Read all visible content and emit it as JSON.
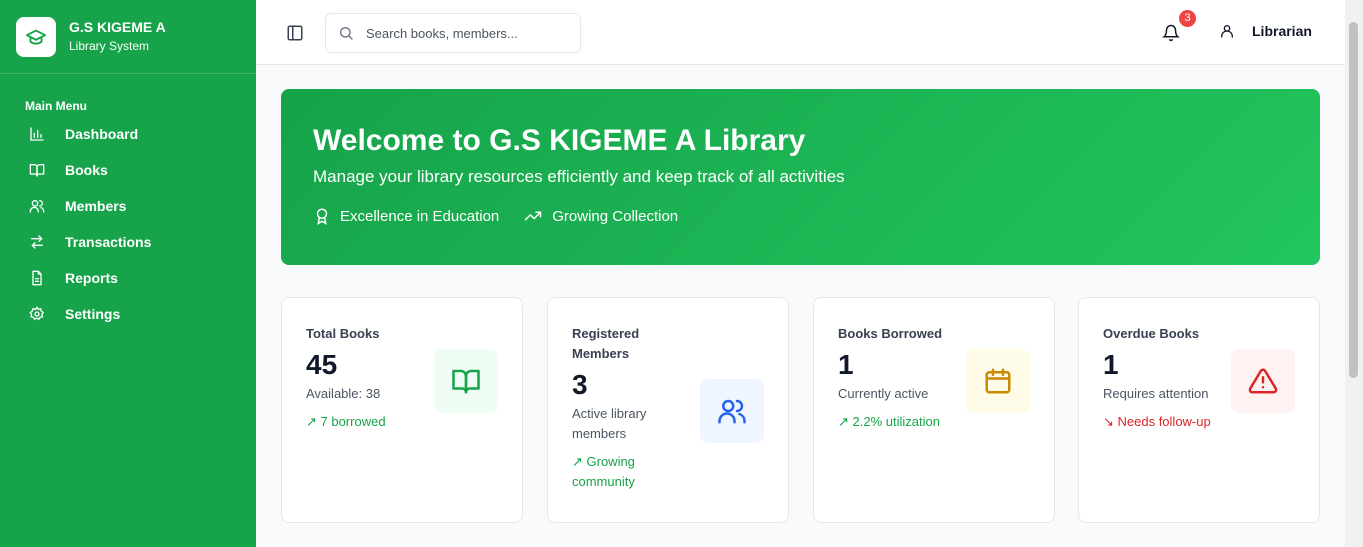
{
  "brand": {
    "name": "G.S KIGEME A",
    "subtitle": "Library System"
  },
  "sidebar": {
    "menu_title": "Main Menu",
    "items": [
      {
        "label": "Dashboard",
        "icon": "bar-chart-icon"
      },
      {
        "label": "Books",
        "icon": "book-open-icon"
      },
      {
        "label": "Members",
        "icon": "users-icon"
      },
      {
        "label": "Transactions",
        "icon": "arrows-left-right-icon"
      },
      {
        "label": "Reports",
        "icon": "file-text-icon"
      },
      {
        "label": "Settings",
        "icon": "gear-icon"
      }
    ]
  },
  "topbar": {
    "search_placeholder": "Search books, members...",
    "notification_count": "3",
    "user_label": "Librarian"
  },
  "hero": {
    "title": "Welcome to G.S KIGEME A Library",
    "subtitle": "Manage your library resources efficiently and keep track of all activities",
    "tags": [
      {
        "label": "Excellence in Education",
        "icon": "award-icon"
      },
      {
        "label": "Growing Collection",
        "icon": "trending-up-icon"
      }
    ]
  },
  "stats": [
    {
      "title": "Total Books",
      "value": "45",
      "sub": "Available: 38",
      "trend": "↗ 7 borrowed",
      "icon": "book-open-icon",
      "trend_color": "#16a34a",
      "icon_bg": "#f0fdf4",
      "icon_color": "#16a34a"
    },
    {
      "title": "Registered Members",
      "value": "3",
      "sub": "Active library members",
      "trend": "↗ Growing community",
      "icon": "users-icon",
      "trend_color": "#16a34a",
      "icon_bg": "#eff6ff",
      "icon_color": "#2563eb"
    },
    {
      "title": "Books Borrowed",
      "value": "1",
      "sub": "Currently active",
      "trend": "↗ 2.2% utilization",
      "icon": "calendar-icon",
      "trend_color": "#16a34a",
      "icon_bg": "#fefce8",
      "icon_color": "#ca8a04"
    },
    {
      "title": "Overdue Books",
      "value": "1",
      "sub": "Requires attention",
      "trend": "↘ Needs follow-up",
      "icon": "alert-triangle-icon",
      "trend_color": "#dc2626",
      "icon_bg": "#fef2f2",
      "icon_color": "#dc2626"
    }
  ]
}
